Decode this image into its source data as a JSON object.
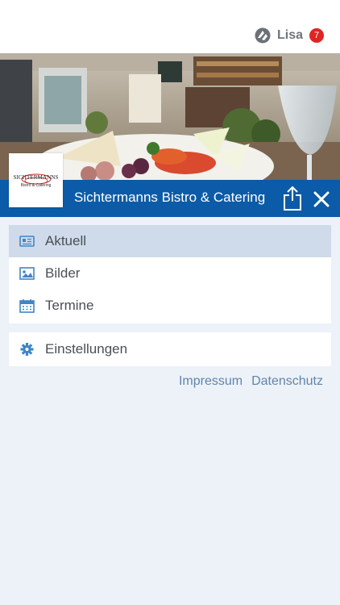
{
  "header": {
    "user_name": "Lisa",
    "notification_count": "7"
  },
  "business": {
    "name": "Sichtermanns Bistro & Catering",
    "logo_text_main": "SICHTERMANNS",
    "logo_text_sub": "Bistro & Catering"
  },
  "menu": {
    "items": [
      {
        "label": "Aktuell",
        "icon": "newspaper-icon",
        "active": true
      },
      {
        "label": "Bilder",
        "icon": "image-icon",
        "active": false
      },
      {
        "label": "Termine",
        "icon": "calendar-icon",
        "active": false
      }
    ],
    "settings_label": "Einstellungen"
  },
  "footer": {
    "impressum": "Impressum",
    "datenschutz": "Datenschutz"
  },
  "colors": {
    "brand_blue": "#0b5ba8",
    "active_row": "#cfdbea",
    "badge_red": "#e02424",
    "background": "#edf1f8"
  }
}
